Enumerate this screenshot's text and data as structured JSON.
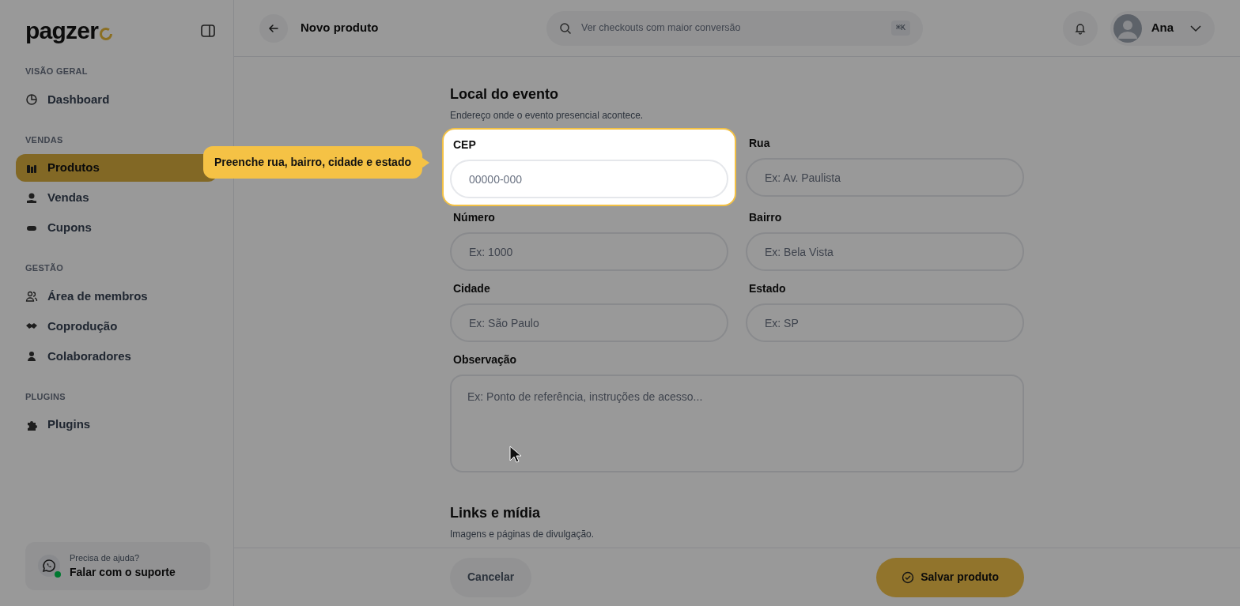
{
  "logo": {
    "text": "pagzer"
  },
  "sidebar": {
    "sections": [
      {
        "heading": "VISÃO GERAL",
        "items": [
          {
            "label": "Dashboard",
            "selected": false
          }
        ]
      },
      {
        "heading": "VENDAS",
        "items": [
          {
            "label": "Produtos",
            "selected": true
          },
          {
            "label": "Vendas",
            "selected": false
          },
          {
            "label": "Cupons",
            "selected": false
          }
        ]
      },
      {
        "heading": "GESTÃO",
        "items": [
          {
            "label": "Área de membros",
            "selected": false
          },
          {
            "label": "Coprodução",
            "selected": false
          },
          {
            "label": "Colaboradores",
            "selected": false
          }
        ]
      },
      {
        "heading": "PLUGINS",
        "items": [
          {
            "label": "Plugins",
            "selected": false
          }
        ]
      }
    ],
    "help": {
      "caption": "Precisa de ajuda?",
      "link": "Falar com o suporte",
      "online": true
    }
  },
  "header": {
    "title": "Novo produto",
    "search": {
      "placeholder": "Ver checkouts com maior conversão",
      "shortcut": "⌘K"
    },
    "user": "Ana"
  },
  "section": {
    "title": "Local do evento",
    "subtitle": "Endereço onde o evento presencial acontece.",
    "fields": [
      {
        "kind": "input",
        "label": "CEP",
        "placeholder": "00000-000",
        "spotlight": true
      },
      {
        "kind": "input",
        "label": "Rua",
        "placeholder": "Ex: Av. Paulista",
        "spotlight": false
      },
      {
        "kind": "input",
        "label": "Número",
        "placeholder": "Ex: 1000",
        "spotlight": false
      },
      {
        "kind": "input",
        "label": "Bairro",
        "placeholder": "Ex: Bela Vista",
        "spotlight": false
      },
      {
        "kind": "input",
        "label": "Cidade",
        "placeholder": "Ex: São Paulo",
        "spotlight": false
      },
      {
        "kind": "input",
        "label": "Estado",
        "placeholder": "Ex: SP",
        "spotlight": false
      },
      {
        "kind": "textarea",
        "label": "Observação",
        "placeholder": "Ex: Ponto de referência, instruções de acesso...",
        "spotlight": false
      }
    ]
  },
  "tooltip": {
    "text": "Preenche rua, bairro, cidade e estado"
  },
  "next_section": {
    "title": "Links e mídia",
    "subtitle": "Imagens e páginas de divulgação."
  },
  "footer": {
    "cancel": "Cancelar",
    "save": "Salvar produto"
  }
}
